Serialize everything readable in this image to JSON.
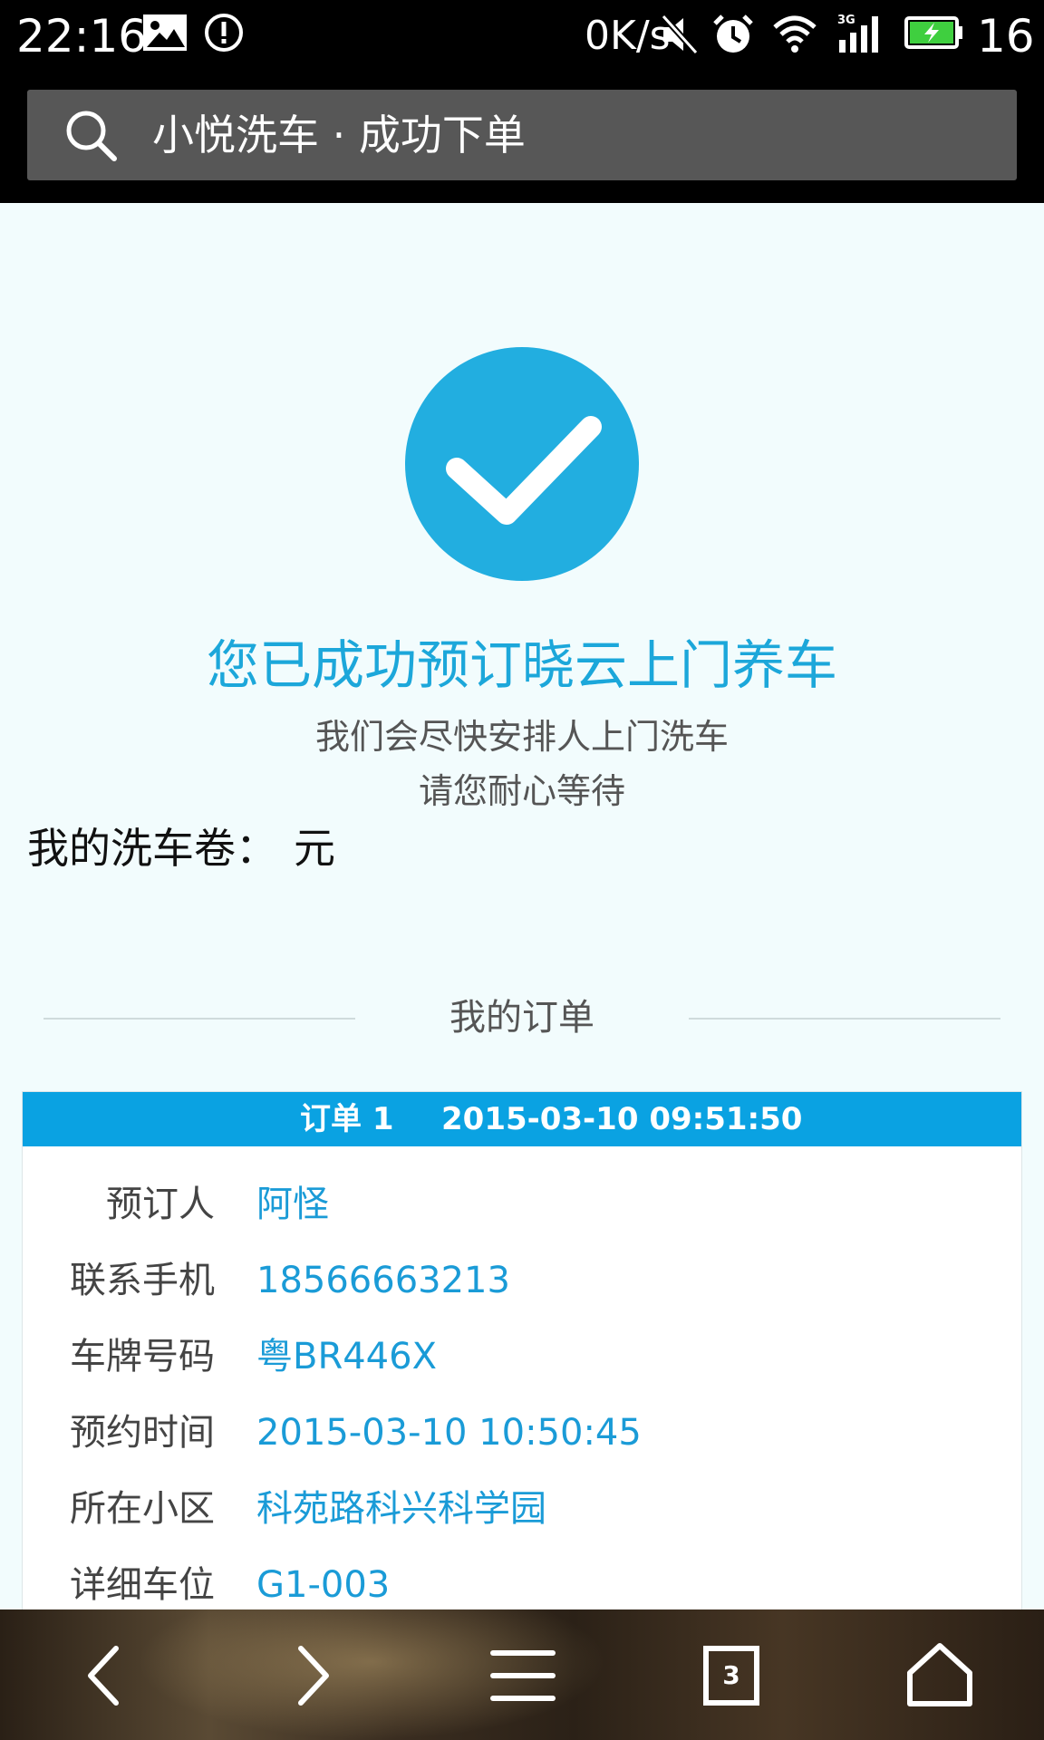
{
  "status_bar": {
    "time": "22:16",
    "speed": "0K/s",
    "battery_level": "16",
    "icons": [
      "image-icon",
      "alert-icon",
      "mute-icon",
      "alarm-icon",
      "wifi-icon",
      "signal-3g-icon",
      "battery-charging-icon"
    ]
  },
  "address_bar": {
    "title": "小悦洗车 · 成功下单",
    "icon": "search-icon"
  },
  "success": {
    "icon": "check-circle-icon",
    "title": "您已成功预订晓云上门养车",
    "line1": "我们会尽快安排人上门洗车",
    "line2": "请您耐心等待"
  },
  "coupon": {
    "label": "我的洗车卷：",
    "value": "元"
  },
  "orders": {
    "section_title": "我的订单",
    "items": [
      {
        "label": "订单 1",
        "created_time": "2015-03-10 09:51:50",
        "fields": [
          {
            "label": "预订人",
            "value": "阿怪"
          },
          {
            "label": "联系手机",
            "value": "18566663213"
          },
          {
            "label": "车牌号码",
            "value": "粤BR446X"
          },
          {
            "label": "预约时间",
            "value": "2015-03-10 10:50:45"
          },
          {
            "label": "所在小区",
            "value": "科苑路科兴科学园"
          },
          {
            "label": "详细车位",
            "value": "G1-003"
          }
        ]
      }
    ]
  },
  "bottom_nav": {
    "tab_count": "3",
    "buttons": [
      "back-icon",
      "forward-icon",
      "menu-icon",
      "tabs-icon",
      "home-icon"
    ]
  },
  "colors": {
    "accent": "#1ca7da",
    "order_header": "#0aa2e2",
    "page_bg": "#f2fcfd"
  }
}
